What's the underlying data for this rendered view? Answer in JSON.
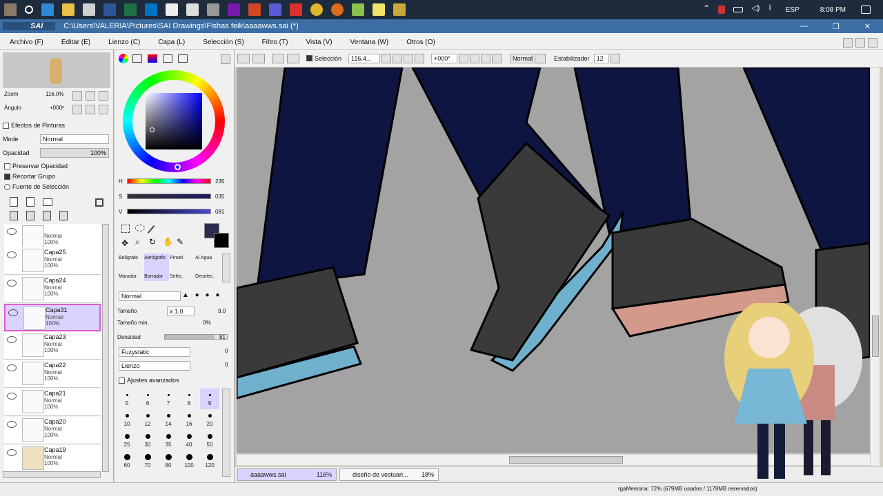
{
  "taskbar": {
    "time": "8:08 PM",
    "lang": "ESP"
  },
  "window": {
    "app_name": "SAI",
    "title": "C:\\Users\\VALERIA\\Pictures\\SAI Drawings\\Fishas feik\\aaaawws.sai (*)"
  },
  "menu": [
    "Archivo (F)",
    "Editar (E)",
    "Lienzo (C)",
    "Capa (L)",
    "Selección (S)",
    "Filtro (T)",
    "Vista (V)",
    "Ventana (W)",
    "Otros (O)"
  ],
  "navigator": {
    "zoom_label": "Zoom",
    "zoom_value": "116.0%",
    "angle_label": "Ángulo",
    "angle_value": "+000ᵒ"
  },
  "layer_panel": {
    "effects_label": "Efectos de Pinturas",
    "mode_label": "Mode",
    "mode_value": "Normal",
    "opacity_label": "Opacidad",
    "opacity_value": "100%",
    "preserve_opacity": "Preservar Opacidad",
    "clip_group": "Recortar Grupo",
    "selection_source": "Fuente de Selección",
    "layers": [
      {
        "name": "",
        "mode": "Normal",
        "opacity": "100%"
      },
      {
        "name": "Capa25",
        "mode": "Normal",
        "opacity": "100%"
      },
      {
        "name": "Capa24",
        "mode": "Normal",
        "opacity": "100%"
      },
      {
        "name": "Capa31",
        "mode": "Normal",
        "opacity": "100%",
        "selected": true
      },
      {
        "name": "Capa23",
        "mode": "Normal",
        "opacity": "100%"
      },
      {
        "name": "Capa22",
        "mode": "Normal",
        "opacity": "100%"
      },
      {
        "name": "Capa21",
        "mode": "Normal",
        "opacity": "100%"
      },
      {
        "name": "Capa20",
        "mode": "Normal",
        "opacity": "100%"
      },
      {
        "name": "Capa19",
        "mode": "Normal",
        "opacity": "100%"
      }
    ]
  },
  "color_panel": {
    "h_label": "H",
    "h_value": "235",
    "s_label": "S",
    "s_value": "035",
    "v_label": "V",
    "v_value": "081",
    "current_color": "#2c2d4a"
  },
  "tools": {
    "brush_row1": [
      "Bolígrafo",
      "Aerógrafo",
      "Pincel",
      "Al Agua"
    ],
    "brush_row2": [
      "Marador",
      "Borrador",
      "Selec.",
      "Deselec."
    ],
    "blend_mode": "Normal",
    "size_label": "Tamaño",
    "size_mult": "x 1.0",
    "size_value": "9.0",
    "min_size_label": "Tamaño min.",
    "min_size_value": "0%",
    "density_label": "Densidad",
    "density_value": "81",
    "texture1": "Fuzystatic",
    "texture1_value": "0",
    "texture2": "Lienzo",
    "texture2_value": "0",
    "advanced_label": "Ajustes avanzados",
    "brush_sizes": [
      "5",
      "6",
      "7",
      "8",
      "9",
      "10",
      "12",
      "14",
      "16",
      "20",
      "25",
      "30",
      "35",
      "40",
      "50",
      "60",
      "70",
      "80",
      "100",
      "120"
    ]
  },
  "toolbar": {
    "selection_label": "Selección",
    "zoom_value": "116.4...",
    "angle_value": "+000°",
    "mode_value": "Normal",
    "stabilizer_label": "Estabilizador",
    "stabilizer_value": "12"
  },
  "doc_tabs": [
    {
      "name": "aaaawws.sai",
      "zoom": "116%"
    },
    {
      "name": "diseño de vestuari...",
      "zoom": "18%"
    }
  ],
  "status": {
    "memory": "rgaMemoria: 72% (679MB usados / 1178MB reservados)"
  },
  "colors": {
    "canvas_bg": "#a3a3a3",
    "pants": "#0d1540",
    "shoe": "#3a3a3a",
    "sole_blue": "#6fb0cc",
    "sole_pink": "#d39a8c",
    "selection": "#d8d4ff"
  }
}
